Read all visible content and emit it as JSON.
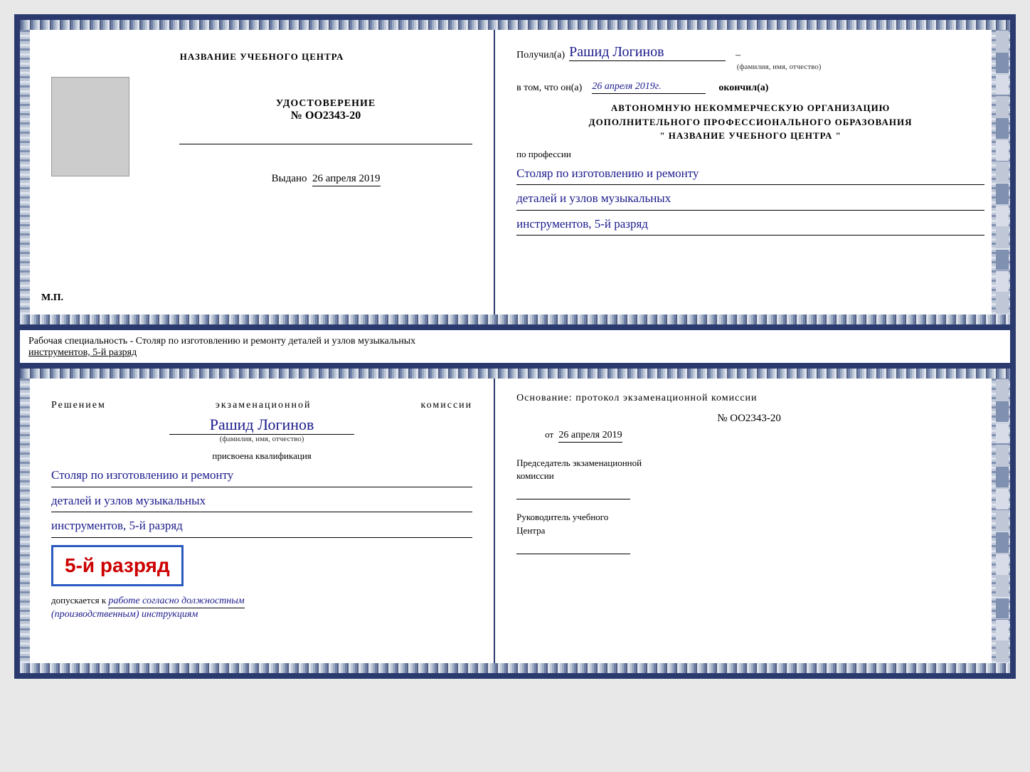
{
  "top_cert": {
    "left": {
      "school_name": "НАЗВАНИЕ УЧЕБНОГО ЦЕНТРА",
      "cert_label": "УДОСТОВЕРЕНИЕ",
      "cert_number": "№ OO2343-20",
      "issued_label": "Выдано",
      "issued_date": "26 апреля 2019",
      "mp_label": "М.П."
    },
    "right": {
      "received_label": "Получил(а)",
      "recipient_name": "Рашид Логинов",
      "fio_sublabel": "(фамилия, имя, отчество)",
      "date_label": "в том, что он(а)",
      "date_value": "26 апреля 2019г.",
      "finished_label": "окончил(а)",
      "org_title_line1": "АВТОНОМНУЮ НЕКОММЕРЧЕСКУЮ ОРГАНИЗАЦИЮ",
      "org_title_line2": "ДОПОЛНИТЕЛЬНОГО ПРОФЕССИОНАЛЬНОГО ОБРАЗОВАНИЯ",
      "org_name_quoted": "\"  НАЗВАНИЕ УЧЕБНОГО ЦЕНТРА  \"",
      "profession_label": "по профессии",
      "profession_line1": "Столяр по изготовлению и ремонту",
      "profession_line2": "деталей и узлов музыкальных",
      "profession_line3": "инструментов, 5-й разряд"
    }
  },
  "middle_label": {
    "text": "Рабочая специальность - Столяр по изготовлению и ремонту деталей и узлов музыкальных",
    "underline_text": "инструментов, 5-й разряд"
  },
  "bottom_cert": {
    "left": {
      "commission_decision": "Решением экзаменационной комиссии",
      "recipient_name": "Рашид Логинов",
      "fio_sublabel": "(фамилия, имя, отчество)",
      "qualification_label": "присвоена квалификация",
      "qual_line1": "Столяр по изготовлению и ремонту",
      "qual_line2": "деталей и узлов музыкальных",
      "qual_line3": "инструментов, 5-й разряд",
      "grade_label": "5-й разряд",
      "допускается_label": "допускается к",
      "допускается_value": "работе согласно должностным",
      "допускается_value2": "(производственным) инструкциям"
    },
    "right": {
      "osnov_label": "Основание: протокол экзаменационной  комиссии",
      "protocol_number": "№  OO2343-20",
      "from_label": "от",
      "from_date": "26 апреля 2019",
      "chairman_label": "Председатель экзаменационной",
      "chairman_label2": "комиссии",
      "head_label": "Руководитель учебного",
      "head_label2": "Центра"
    }
  }
}
